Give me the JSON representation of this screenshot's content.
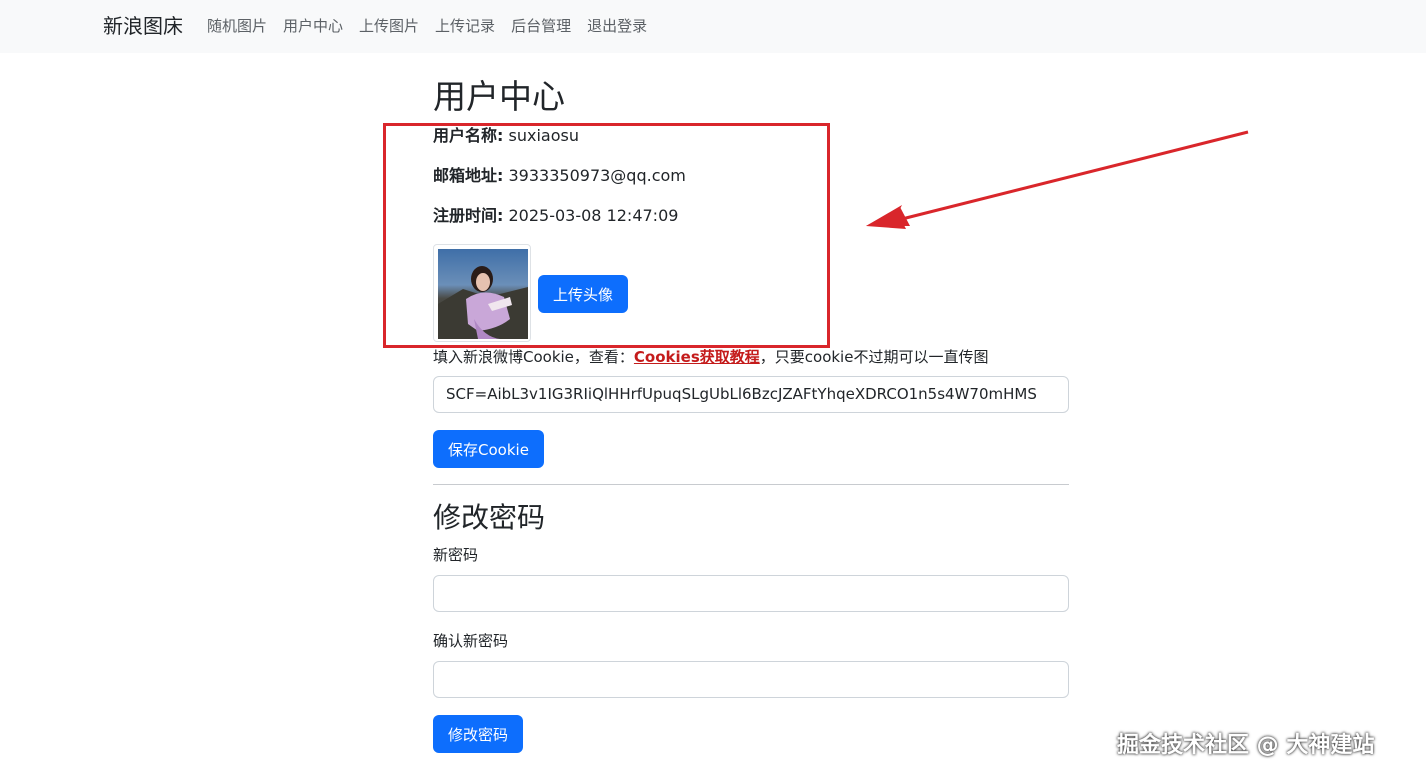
{
  "navbar": {
    "brand": "新浪图床",
    "links": [
      "随机图片",
      "用户中心",
      "上传图片",
      "上传记录",
      "后台管理",
      "退出登录"
    ]
  },
  "profile": {
    "title": "用户中心",
    "username_label": "用户名称:",
    "username": "suxiaosu",
    "email_label": "邮箱地址:",
    "email": "3933350973@qq.com",
    "registered_label": "注册时间:",
    "registered": "2025-03-08 12:47:09",
    "upload_avatar_button": "上传头像"
  },
  "cookie": {
    "hint_prefix": "填入新浪微博Cookie，查看：",
    "hint_link": "Cookies获取教程",
    "hint_suffix": "，只要cookie不过期可以一直传图",
    "value": "SCF=AibL3v1IG3RIiQlHHrfUpuqSLgUbLl6BzcJZAFtYhqeXDRCO1n5s4W70mHMS",
    "save_button": "保存Cookie"
  },
  "password": {
    "title": "修改密码",
    "new_label": "新密码",
    "confirm_label": "确认新密码",
    "submit_button": "修改密码"
  },
  "watermark": "掘金技术社区 @ 大神建站",
  "colors": {
    "primary": "#0d6efd",
    "highlight": "#d9262b",
    "link": "#c41b1b"
  }
}
